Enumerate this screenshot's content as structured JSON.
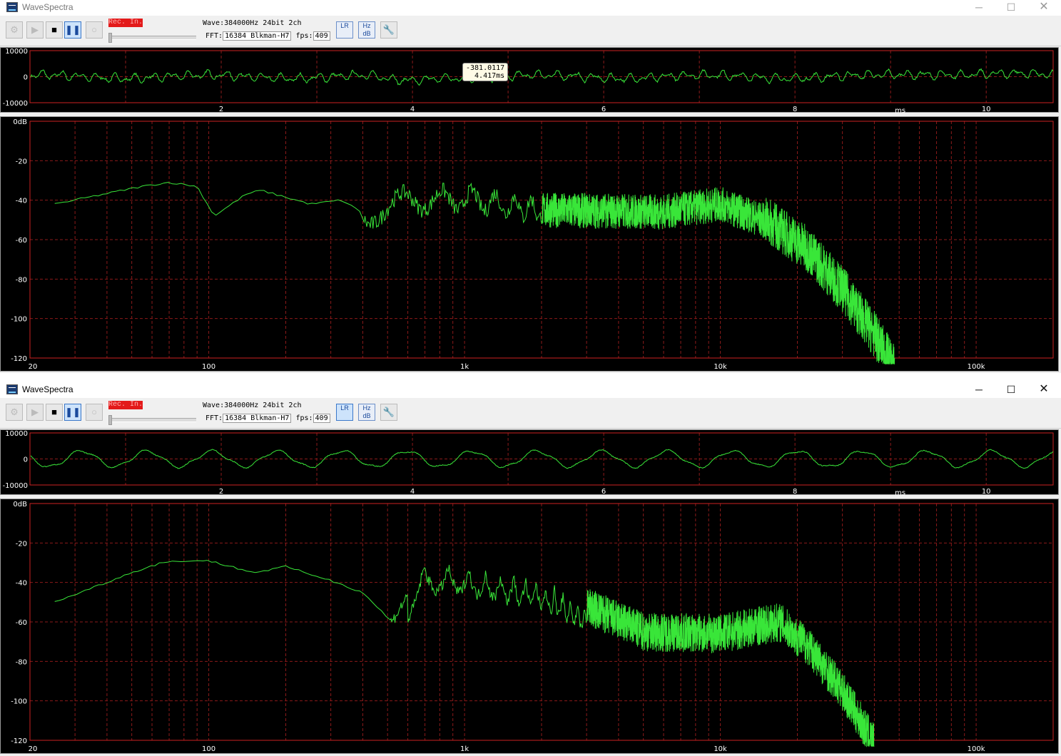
{
  "windows": [
    {
      "id": "win1",
      "title": "WaveSpectra",
      "buttons": {
        "min": "─",
        "max": "☐",
        "close": "✕"
      },
      "rec_label": "Rec. In.",
      "wave_label": "Wave:",
      "wave_value": "384000Hz 24bit 2ch",
      "fft_label": "FFT:",
      "fft_value": "16384 Blkman-H7",
      "fps_label": "fps:",
      "fps_value": "409",
      "lr_label": "LR",
      "hzdb_top": "Hz",
      "hzdb_bottom": "dB",
      "tooltip": {
        "value": "-381.0117",
        "time": "4.417ms"
      },
      "scope": {
        "y_ticks": [
          "10000",
          "0",
          "-10000"
        ],
        "x_ticks": [
          "2",
          "4",
          "6",
          "8",
          "10"
        ],
        "x_unit": "ms"
      },
      "spectrum": {
        "y_ticks": [
          "0dB",
          "-20",
          "-40",
          "-60",
          "-80",
          "-100",
          "-120"
        ],
        "x_ticks": [
          "20",
          "100",
          "1k",
          "10k",
          "100k"
        ]
      }
    },
    {
      "id": "win2",
      "title": "WaveSpectra",
      "buttons": {
        "min": "─",
        "max": "☐",
        "close": "✕"
      },
      "rec_label": "Rec. In.",
      "wave_label": "Wave:",
      "wave_value": "384000Hz 24bit 2ch",
      "fft_label": "FFT:",
      "fft_value": "16384 Blkman-H7",
      "fps_label": "fps:",
      "fps_value": "409",
      "lr_label": "LR",
      "hzdb_top": "Hz",
      "hzdb_bottom": "dB",
      "scope": {
        "y_ticks": [
          "10000",
          "0",
          "-10000"
        ],
        "x_ticks": [
          "2",
          "4",
          "6",
          "8",
          "10"
        ],
        "x_unit": "ms"
      },
      "spectrum": {
        "y_ticks": [
          "0dB",
          "-20",
          "-40",
          "-60",
          "-80",
          "-100",
          "-120"
        ],
        "x_ticks": [
          "20",
          "100",
          "1k",
          "10k",
          "100k"
        ]
      }
    }
  ],
  "colors": {
    "trace": "#39e639",
    "grid": "#8b1a1a",
    "frame": "#cc2222",
    "scope_bg": "#000000",
    "rec_badge": "#e31a1a"
  },
  "icons": [
    "settings-icon",
    "play-icon",
    "stop-icon",
    "pause-icon",
    "record-icon",
    "lr-icon",
    "hz-db-icon",
    "wrench-icon"
  ]
}
